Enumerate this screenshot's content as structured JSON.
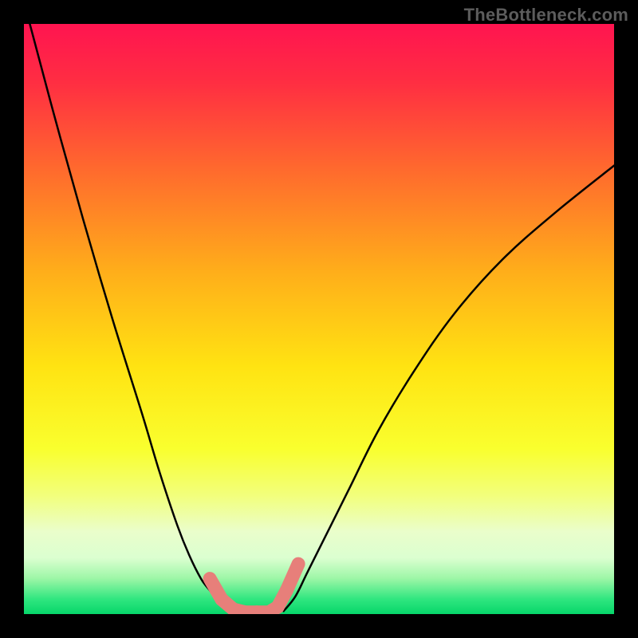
{
  "watermark": "TheBottleneck.com",
  "chart_data": {
    "type": "line",
    "title": "",
    "xlabel": "",
    "ylabel": "",
    "xlim": [
      0,
      100
    ],
    "ylim": [
      0,
      100
    ],
    "grid": false,
    "series": [
      {
        "name": "left-curve",
        "x": [
          1,
          5,
          10,
          15,
          20,
          23,
          26,
          28,
          30,
          31.5,
          33,
          34.5,
          36
        ],
        "y": [
          100,
          85,
          67,
          50,
          34,
          24,
          15,
          10,
          6,
          4,
          2.2,
          1.2,
          0.5
        ],
        "stroke": "#000000",
        "width": 2.5
      },
      {
        "name": "right-curve",
        "x": [
          44,
          46,
          48,
          51,
          55,
          60,
          66,
          73,
          81,
          90,
          100
        ],
        "y": [
          0.5,
          3,
          7,
          13,
          21,
          31,
          41,
          51,
          60,
          68,
          76
        ],
        "stroke": "#000000",
        "width": 2.5
      },
      {
        "name": "marker-strip",
        "shape": "rounded-segments",
        "x": [
          31.5,
          33.5,
          35.5,
          37.5,
          39.5,
          41.5,
          43,
          44.5,
          46.5
        ],
        "y": [
          6,
          2.5,
          0.8,
          0.3,
          0.3,
          0.3,
          1.2,
          4,
          8.5
        ],
        "color": "#e77f7a"
      }
    ],
    "background_gradient": {
      "stops": [
        {
          "offset": 0.0,
          "color": "#ff1450"
        },
        {
          "offset": 0.1,
          "color": "#ff2e42"
        },
        {
          "offset": 0.25,
          "color": "#ff6b2d"
        },
        {
          "offset": 0.42,
          "color": "#ffae1a"
        },
        {
          "offset": 0.58,
          "color": "#ffe312"
        },
        {
          "offset": 0.72,
          "color": "#f9ff2e"
        },
        {
          "offset": 0.8,
          "color": "#f2ff7d"
        },
        {
          "offset": 0.86,
          "color": "#eafecb"
        },
        {
          "offset": 0.905,
          "color": "#dbffd0"
        },
        {
          "offset": 0.94,
          "color": "#9cf6a6"
        },
        {
          "offset": 0.975,
          "color": "#2fe67f"
        },
        {
          "offset": 1.0,
          "color": "#07d66a"
        }
      ]
    }
  }
}
